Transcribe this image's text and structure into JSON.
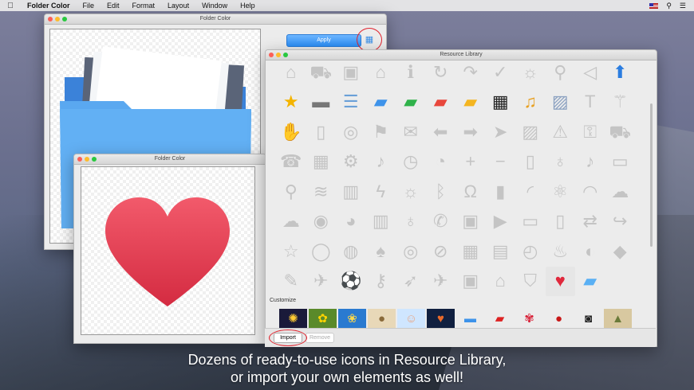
{
  "menubar": {
    "app_name": "Folder Color",
    "items": [
      "File",
      "Edit",
      "Format",
      "Layout",
      "Window",
      "Help"
    ]
  },
  "main_window": {
    "title": "Folder Color",
    "apply_label": "Apply"
  },
  "second_window": {
    "title": "Folder Color"
  },
  "resource_library": {
    "title": "Resource Library",
    "customize_label": "Customize",
    "import_label": "Import",
    "remove_label": "Remove",
    "icons": [
      "tags-icon",
      "cart-icon",
      "briefcase-icon",
      "home-icon",
      "info-icon",
      "refresh-icon",
      "redo-icon",
      "checkmark-icon",
      "lightbulb-icon",
      "search-icon",
      "speaker-icon",
      "arrow-up-icon",
      "star-icon",
      "harddrive-icon",
      "document-icon",
      "folder-blue-icon",
      "folder-green-icon",
      "folder-red-icon",
      "folder-yellow-icon",
      "film-icon",
      "music-note-icon",
      "photo-icon",
      "text-icon",
      "magic-wand-icon",
      "hand-icon",
      "book-icon",
      "compass-icon",
      "flag-icon",
      "mail-icon",
      "arrow-left-icon",
      "arrow-right-icon",
      "location-arrow-icon",
      "image-icon",
      "warning-icon",
      "lock-icon",
      "cart-outline-icon",
      "address-book-icon",
      "grid-icon",
      "gear-icon",
      "bell-icon",
      "alarm-clock-icon",
      "clock-icon",
      "plus-icon",
      "minus-icon",
      "file-icon",
      "microphone-icon",
      "music-icon",
      "folder-outline-icon",
      "map-pin-icon",
      "layers-icon",
      "map-icon",
      "lightning-icon",
      "lightbulb-outline-icon",
      "bluetooth-icon",
      "headphones-icon",
      "battery-icon",
      "rss-icon",
      "atom-icon",
      "wifi-icon",
      "cloud-upload-icon",
      "cloud-download-icon",
      "disc-icon",
      "pie-chart-icon",
      "bar-chart-icon",
      "mic-stand-icon",
      "phone-icon",
      "floppy-icon",
      "video-camera-icon",
      "monitor-icon",
      "trash-icon",
      "shuffle-icon",
      "share-icon",
      "star-outline-icon",
      "speech-bubble-icon",
      "globe-icon",
      "tree-icon",
      "target-icon",
      "prohibited-icon",
      "filmstrip-icon",
      "clapperboard-icon",
      "dashboard-icon",
      "flame-icon",
      "planet-icon",
      "eraser-icon",
      "pencil-icon",
      "paper-plane-icon",
      "soccer-ball-icon",
      "key-icon",
      "rocket-icon",
      "airplane-icon",
      "briefcase-outline-icon",
      "house-icon",
      "tshirt-icon",
      "heart-icon",
      "folder-light-blue-icon"
    ],
    "customize_items": [
      "fireworks-thumb",
      "sunflowers-thumb",
      "flowers-thumb",
      "dog-thumb",
      "child-thumb",
      "hands-thumb",
      "folder-thumb",
      "car-thumb",
      "rose-thumb",
      "apple-thumb",
      "camera-thumb",
      "landscape-thumb"
    ]
  },
  "caption": {
    "line1": "Dozens of ready-to-use icons in Resource Library,",
    "line2": "or import your own elements as well!"
  }
}
